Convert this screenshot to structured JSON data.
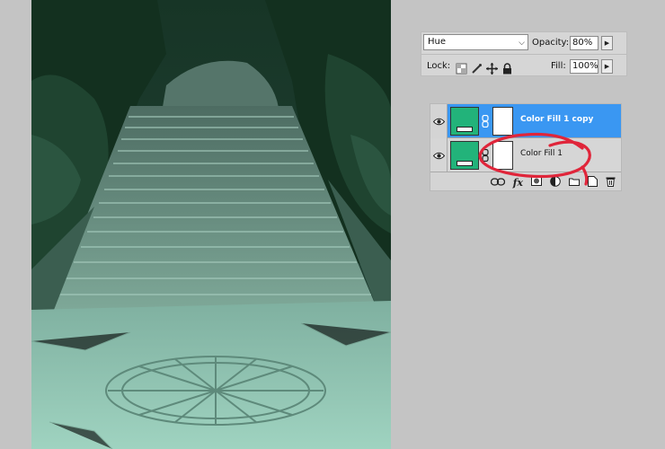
{
  "blend": {
    "mode": "Hue",
    "opacity_label": "Opacity:",
    "opacity_value": "80%",
    "lock_label": "Lock:",
    "fill_label": "Fill:",
    "fill_value": "100%",
    "lock_icons": [
      "lock-transparent-pixels-icon",
      "lock-image-pixels-icon",
      "lock-position-icon",
      "lock-all-icon"
    ]
  },
  "layers": [
    {
      "name": "Color Fill 1 copy",
      "selected": true,
      "visible": true,
      "fill_color": "#22b37a"
    },
    {
      "name": "Color Fill 1",
      "selected": false,
      "visible": true,
      "fill_color": "#22b37a"
    }
  ],
  "toolbar_icons": [
    "link-layers-icon",
    "fx-icon",
    "add-mask-icon",
    "adjustment-layer-icon",
    "new-group-icon",
    "new-layer-icon",
    "trash-icon"
  ],
  "fx_text": "fx",
  "colors": {
    "selected_row": "#3a97f2",
    "annotation": "#e0253a",
    "canvas_tint": "#1e3f31"
  }
}
